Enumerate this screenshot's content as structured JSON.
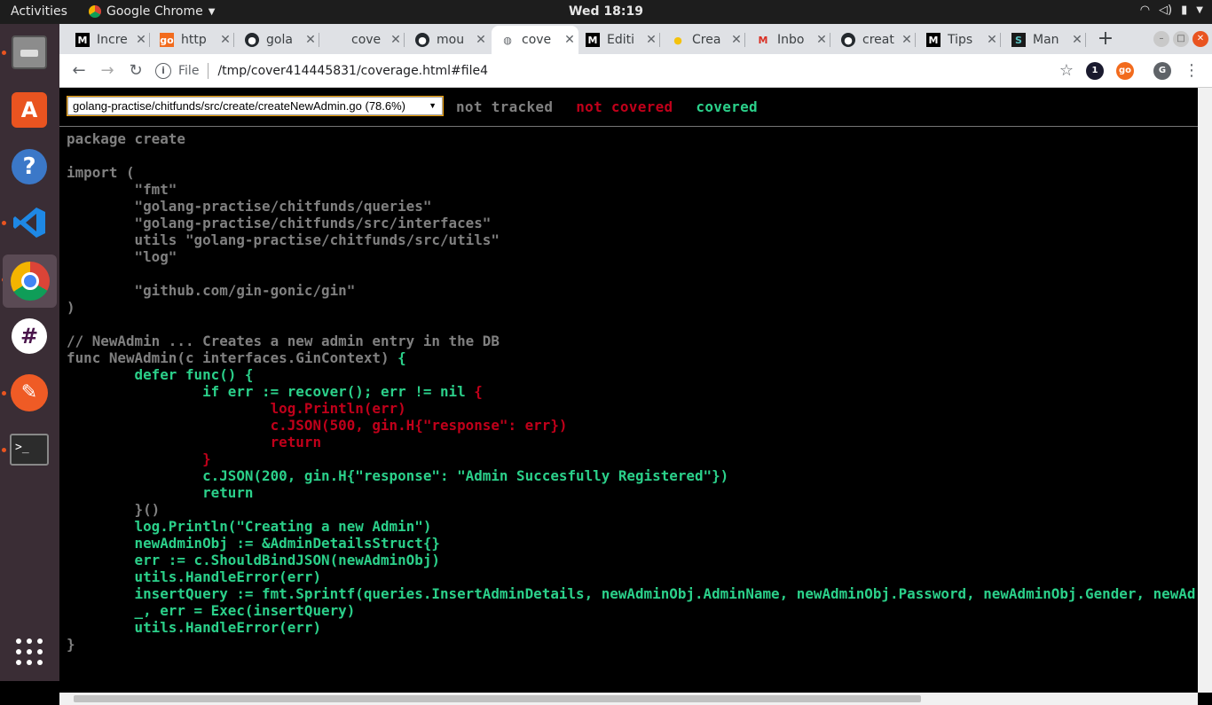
{
  "topbar": {
    "activities": "Activities",
    "app_name": "Google Chrome",
    "clock": "Wed 18:19"
  },
  "dock": {
    "items": [
      "files-icon",
      "software-center-icon",
      "help-icon",
      "vscode-icon",
      "chrome-icon",
      "slack-icon",
      "postman-icon",
      "terminal-icon",
      "show-apps-icon"
    ]
  },
  "tabs": [
    {
      "title": "Incre",
      "fav": "M"
    },
    {
      "title": "http",
      "fav": "go"
    },
    {
      "title": "gola",
      "fav": "gh"
    },
    {
      "title": "cove",
      "fav": ""
    },
    {
      "title": "mou",
      "fav": "gh"
    },
    {
      "title": "cove",
      "fav": "globe",
      "active": true
    },
    {
      "title": "Editi",
      "fav": "M"
    },
    {
      "title": "Crea",
      "fav": "bulb"
    },
    {
      "title": "Inbo",
      "fav": "gmail"
    },
    {
      "title": "creat",
      "fav": "gh"
    },
    {
      "title": "Tips",
      "fav": "M"
    },
    {
      "title": "Man",
      "fav": "sj"
    }
  ],
  "toolbar": {
    "file_label": "File",
    "url": "/tmp/cover414445831/coverage.html#file4"
  },
  "extensions": {
    "ext1": "1",
    "ext2": "go",
    "profile": "G"
  },
  "coverage": {
    "selected_file": "golang-practise/chitfunds/src/create/createNewAdmin.go (78.6%)",
    "legend": {
      "not_tracked": "not tracked",
      "not_covered": "not covered",
      "covered": "covered"
    },
    "colors": {
      "not_tracked": "#808080",
      "not_covered": "#c0001a",
      "covered": "#2bd08a"
    },
    "lines": [
      [
        [
          "nt",
          "package create"
        ]
      ],
      [
        [
          "nt",
          ""
        ]
      ],
      [
        [
          "nt",
          "import ("
        ]
      ],
      [
        [
          "nt",
          "        \"fmt\""
        ]
      ],
      [
        [
          "nt",
          "        \"golang-practise/chitfunds/queries\""
        ]
      ],
      [
        [
          "nt",
          "        \"golang-practise/chitfunds/src/interfaces\""
        ]
      ],
      [
        [
          "nt",
          "        utils \"golang-practise/chitfunds/src/utils\""
        ]
      ],
      [
        [
          "nt",
          "        \"log\""
        ]
      ],
      [
        [
          "nt",
          ""
        ]
      ],
      [
        [
          "nt",
          "        \"github.com/gin-gonic/gin\""
        ]
      ],
      [
        [
          "nt",
          ")"
        ]
      ],
      [
        [
          "nt",
          ""
        ]
      ],
      [
        [
          "nt",
          "// NewAdmin ... Creates a new admin entry in the DB"
        ]
      ],
      [
        [
          "nt",
          "func NewAdmin(c interfaces.GinContext) "
        ],
        [
          "cv",
          "{"
        ]
      ],
      [
        [
          "cv",
          "        defer func() {"
        ]
      ],
      [
        [
          "cv",
          "                if err := recover(); err != nil "
        ],
        [
          "nc",
          "{"
        ]
      ],
      [
        [
          "nc",
          "                        log.Println(err)"
        ]
      ],
      [
        [
          "nc",
          "                        c.JSON(500, gin.H{\"response\": err})"
        ]
      ],
      [
        [
          "nc",
          "                        return"
        ]
      ],
      [
        [
          "nc",
          "                }"
        ]
      ],
      [
        [
          "cv",
          "                c.JSON(200, gin.H{\"response\": \"Admin Succesfully Registered\"})"
        ]
      ],
      [
        [
          "cv",
          "                return"
        ]
      ],
      [
        [
          "nt",
          "        }()"
        ]
      ],
      [
        [
          "cv",
          "        log.Println(\"Creating a new Admin\")"
        ]
      ],
      [
        [
          "cv",
          "        newAdminObj := &AdminDetailsStruct{}"
        ]
      ],
      [
        [
          "cv",
          "        err := c.ShouldBindJSON(newAdminObj)"
        ]
      ],
      [
        [
          "cv",
          "        utils.HandleError(err)"
        ]
      ],
      [
        [
          "cv",
          "        insertQuery := fmt.Sprintf(queries.InsertAdminDetails, newAdminObj.AdminName, newAdminObj.Password, newAdminObj.Gender, newAd"
        ]
      ],
      [
        [
          "cv",
          "        _, err = Exec(insertQuery)"
        ]
      ],
      [
        [
          "cv",
          "        utils.HandleError(err)"
        ]
      ],
      [
        [
          "nt",
          "}"
        ]
      ]
    ]
  }
}
